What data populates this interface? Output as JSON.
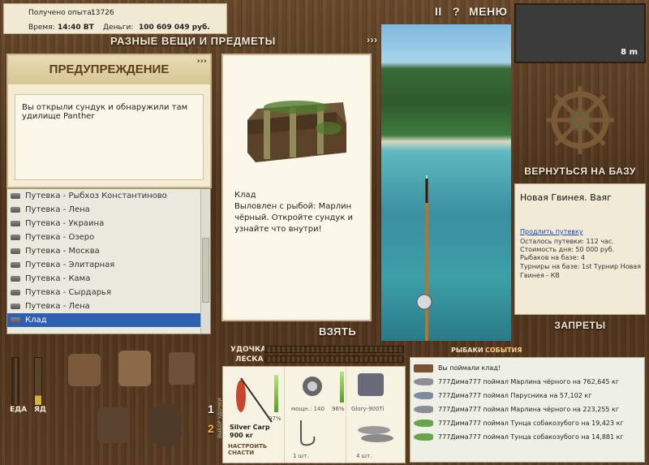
{
  "status": {
    "experience_label": "Получено опыта:",
    "experience_value": "13726",
    "time_label": "Время:",
    "time_value": "14:40 ВТ",
    "money_label": "Деньги:",
    "money_value": "100 609 049 руб."
  },
  "topbar": {
    "pause_label": "II",
    "help_label": "?",
    "menu_label": "МЕНЮ"
  },
  "minimap": {
    "depth": "8 m"
  },
  "inventory_panel": {
    "title": "РАЗНЫЕ ВЕЩИ И ПРЕДМЕТЫ",
    "arrows": "›››"
  },
  "warning": {
    "title": "ПРЕДУПРЕЖДЕНИЕ",
    "arrows": "›››",
    "text": "Вы открыли сундук и обнаружили там удилище Panther"
  },
  "items": [
    {
      "label": "Путевка - Рыбхоз Константиново",
      "selected": false
    },
    {
      "label": "Путевка - Лена",
      "selected": false
    },
    {
      "label": "Путевка - Украина",
      "selected": false
    },
    {
      "label": "Путевка - Озеро",
      "selected": false
    },
    {
      "label": "Путевка - Москва",
      "selected": false
    },
    {
      "label": "Путевка - Элитарная",
      "selected": false
    },
    {
      "label": "Путевка - Кама",
      "selected": false
    },
    {
      "label": "Путевка - Сырдарья",
      "selected": false
    },
    {
      "label": "Путевка - Лена",
      "selected": false
    },
    {
      "label": "Клад",
      "selected": true
    }
  ],
  "info_card": {
    "title": "Клад",
    "text": "Выловлен с рыбой: Марлин чёрный. Откройте сундук и узнайте что внутри!"
  },
  "take_button": "ВЗЯТЬ",
  "return_button": "ВЕРНУТЬСЯ НА БАЗУ",
  "base_info": {
    "location": "Новая Гвинея. Ваяг",
    "extend_link": "Продлить путевку",
    "remaining": "Осталось путевки: 112 час.",
    "day_cost": "Стоимость дня: 50 000 руб.",
    "anglers": "Рыбаков на базе: 4",
    "tournaments": "Турниры на базе: 1st Турнир Новая Гвинея - КВ"
  },
  "bans_button": "ЗАПРЕТЫ",
  "bottom": {
    "rod_label": "УДОЧКА",
    "line_label": "ЛЕСКА",
    "food_label": "ЕДА",
    "poison_label": "ЯД",
    "tabs": [
      "РЫБАКИ",
      "СОБЫТИЯ"
    ],
    "rod_slot_1": "1",
    "rod_slot_2": "2",
    "rod_slot_caption": "ВЫБОР УДОЧКИ"
  },
  "gear": {
    "rod_pct": "97%",
    "reel_caption": "мощн.: 140",
    "reel_pct": "96%",
    "line_name": "Glory-900Ti",
    "bait_name": "Silver Carp",
    "bait_weight": "900 кг",
    "setup_label": "НАСТРОИТЬ СНАСТИ",
    "hooks_qty": "1 шт.",
    "fish_qty": "4 шт."
  },
  "events": {
    "head": "Вы поймали клад!",
    "rows": [
      {
        "text": "777Дима777 поймал Марлина чёрного на 762,645 кг",
        "color": "#8a8e96"
      },
      {
        "text": "777Дима777 поймал Парусника на 57,102 кг",
        "color": "#7f8ca0"
      },
      {
        "text": "777Дима777 поймал Марлина чёрного на 223,255 кг",
        "color": "#8a8e96"
      },
      {
        "text": "777Дима777 поймал Тунца собакозубого на 19,423 кг",
        "color": "#6aa34a"
      },
      {
        "text": "777Дима777 поймал Тунца собакозубого на 14,881 кг",
        "color": "#6aa34a"
      }
    ]
  },
  "colors": {
    "accent_selected": "#2e5fb3",
    "panel_cream": "#f3ecd3",
    "wood": "#5b3c22"
  }
}
